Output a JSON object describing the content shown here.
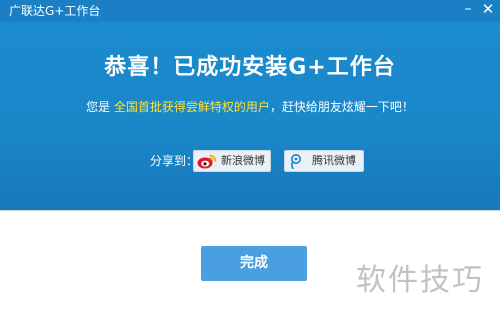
{
  "window": {
    "title": "广联达G+工作台",
    "minimize_label": "–",
    "close_label": "✕"
  },
  "banner": {
    "headline": "恭喜！已成功安装G+工作台",
    "subline": {
      "prefix": "您是",
      "highlight": "全国首批获得尝鲜特权的用户",
      "suffix": "，赶快给朋友炫耀一下吧！"
    },
    "share": {
      "label": "分享到：",
      "weibo_label": "新浪微博",
      "weibo_icon": "sina-weibo-icon",
      "tencent_label": "腾讯微博",
      "tencent_icon": "tencent-weibo-icon"
    }
  },
  "footer": {
    "done_label": "完成"
  },
  "watermark": {
    "text": "软件技巧"
  },
  "colors": {
    "titlebar": "#1a7fc4",
    "banner": "#1a86c8",
    "highlight_text": "#ffe23a",
    "done_button": "#4a9fe0"
  }
}
